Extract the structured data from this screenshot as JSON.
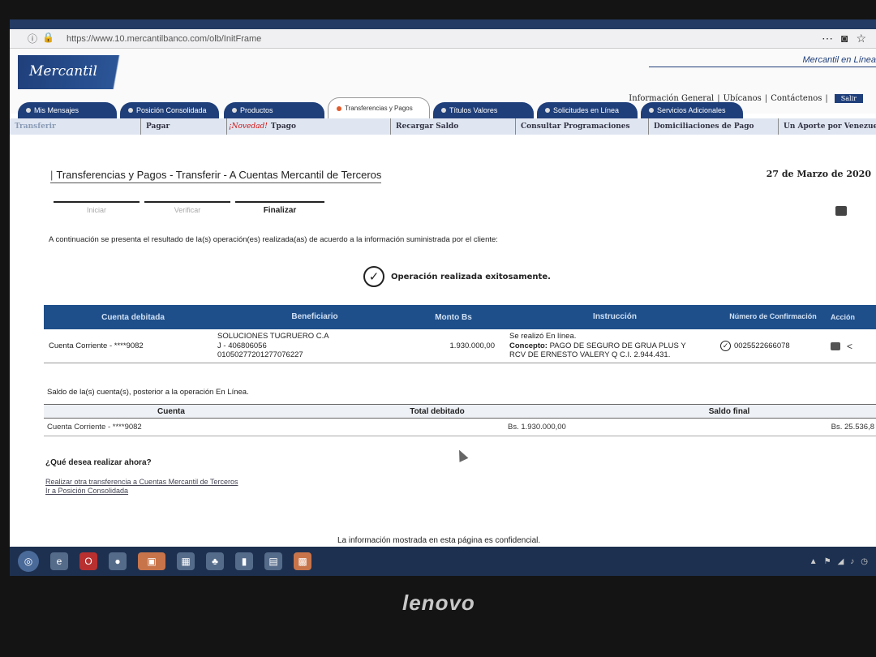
{
  "browser": {
    "url": "https://www.10.mercantilbanco.com/olb/InitFrame"
  },
  "header": {
    "logo": "Mercantil",
    "tagline": "Mercantil en Línea",
    "links": [
      "Información General",
      "Ubícanos",
      "Contáctenos"
    ],
    "salir": "Salir"
  },
  "tabs": [
    {
      "label": "Mis Mensajes"
    },
    {
      "label": "Posición Consolidada"
    },
    {
      "label": "Productos"
    },
    {
      "label": "Transferencias y Pagos",
      "active": true
    },
    {
      "label": "Títulos Valores"
    },
    {
      "label": "Solicitudes en Línea"
    },
    {
      "label": "Servicios Adicionales"
    }
  ],
  "subnav": [
    {
      "label": "Transferir"
    },
    {
      "label": "Pagar"
    },
    {
      "highlight": "¡Novedad!",
      "label": "Tpago"
    },
    {
      "label": "Recargar Saldo"
    },
    {
      "label": "Consultar Programaciones"
    },
    {
      "label": "Domiciliaciones de Pago"
    },
    {
      "label": "Un Aporte por Venezuela"
    }
  ],
  "page": {
    "title": "Transferencias y Pagos - Transferir - A Cuentas Mercantil de Terceros",
    "date": "27 de Marzo de 2020",
    "steps": [
      "Iniciar",
      "Verificar",
      "Finalizar"
    ],
    "intro": "A continuación se presenta el resultado de la(s) operación(es) realizada(as) de acuerdo a la información suministrada por el cliente:",
    "success": "Operación realizada exitosamente."
  },
  "result_table": {
    "headers": [
      "Cuenta debitada",
      "Beneficiario",
      "Monto Bs",
      "Instrucción",
      "Número de Confirmación",
      "Acción"
    ],
    "row": {
      "cuenta": "Cuenta Corriente - ****9082",
      "beneficiario_nombre": "SOLUCIONES TUGRUERO C.A",
      "beneficiario_rif": "J - 406806056",
      "beneficiario_cuenta": "01050277201277076227",
      "monto": "1.930.000,00",
      "instruccion_estado": "Se realizó En línea.",
      "concepto_label": "Concepto:",
      "concepto_texto": "PAGO DE SEGURO DE GRUA PLUS Y",
      "concepto_linea2": "RCV DE ERNESTO VALERY Q C.I. 2.944.431.",
      "confirmacion": "0025522666078"
    }
  },
  "saldo": {
    "text": "Saldo de la(s) cuenta(s), posterior a la operación En Línea.",
    "headers": [
      "Cuenta",
      "Total debitado",
      "Saldo final"
    ],
    "row": {
      "cuenta": "Cuenta Corriente - ****9082",
      "total": "Bs. 1.930.000,00",
      "saldo": "Bs. 25.536,8"
    }
  },
  "next": {
    "question": "¿Qué desea realizar ahora?",
    "links": [
      "Realizar otra transferencia a Cuentas Mercantil de Terceros",
      "Ir a Posición Consolidada"
    ]
  },
  "footer": {
    "confidential": "La información mostrada en esta página es confidencial."
  },
  "laptop": {
    "brand": "lenovo"
  }
}
